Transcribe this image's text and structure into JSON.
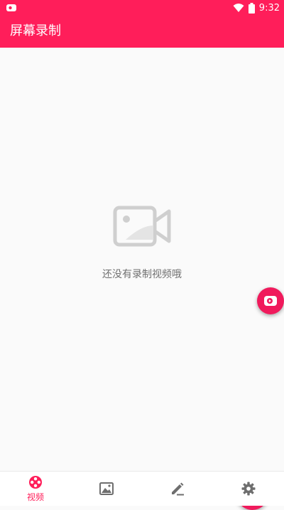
{
  "statusbar": {
    "time": "9:32"
  },
  "appbar": {
    "title": "屏幕录制"
  },
  "empty_state": {
    "message": "还没有录制视频哦"
  },
  "bottom_nav": {
    "items": [
      {
        "label": "视频",
        "icon": "film-reel-icon",
        "active": true
      },
      {
        "label": "",
        "icon": "image-icon",
        "active": false
      },
      {
        "label": "",
        "icon": "pencil-icon",
        "active": false
      },
      {
        "label": "",
        "icon": "gear-icon",
        "active": false
      }
    ]
  },
  "colors": {
    "primary": "#ff1e5a",
    "fab": "#f01a5c",
    "inactive_icon": "#6e6e6e"
  }
}
